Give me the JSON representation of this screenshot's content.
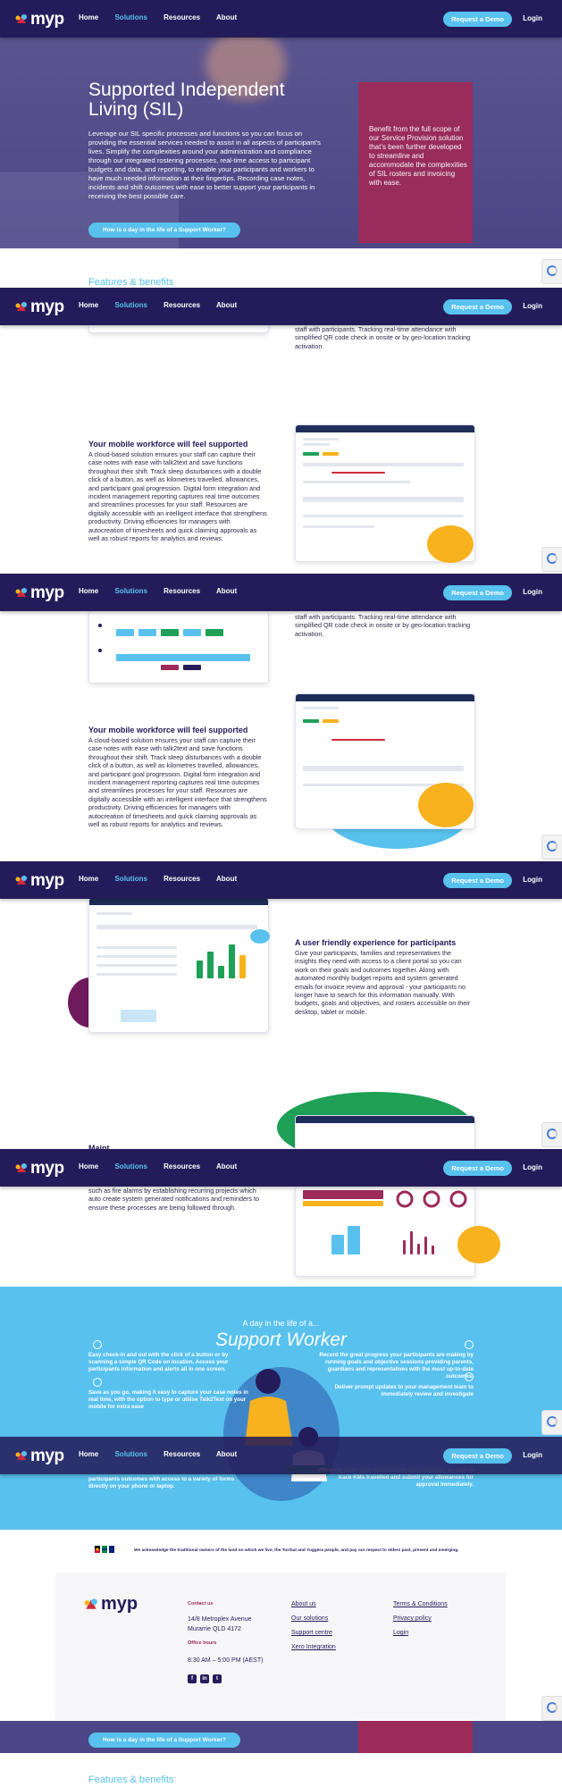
{
  "nav": {
    "logo": "myp",
    "links": [
      "Home",
      "Solutions",
      "Resources",
      "About"
    ],
    "active": "Solutions",
    "demo_button": "Request a Demo",
    "login": "Login"
  },
  "hero": {
    "title": "Supported Independent Living (SIL)",
    "body": "Leverage our SIL specific processes and functions so you can focus on providing the essential services needed to assist in all aspects of participant’s lives.  Simplify the complexities around your administration and compliance through our integrated rostering processes, real-time access to participant budgets and data, and reporting, to enable your participants and workers to have much needed information at their fingertips. Recording case notes, incidents and shift outcomes with ease to better support your participants in receiving the best possible care.",
    "cta": "How is a day in the life of a Support Worker?",
    "panel": "Benefit from the full scope of our Service Provision solution that’s been further developed to streamline and accommodate the complexities of SIL rosters and invoicing with ease."
  },
  "features_heading": "Features & benefits",
  "attendance_text": "staff with participants. Tracking real-time attendance with simplified QR code check in onsite or by geo-location tracking activation.",
  "mobile": {
    "heading": "Your mobile workforce will feel supported",
    "body": "A cloud-based solution ensures your staff can capture their case notes with ease with talk2text and save functions throughout their shift.  Track sleep disturbances with a double click of a button, as well as kilometres travelled, allowances, and participant goal progression.  Digital form integration and incident management reporting captures real time outcomes and streamlines processes for your staff.  Resources are digitally accessible with an intelligent interface that strengthens productivity.  Driving efficiencies for managers with autocreation of timesheets and quick claiming approvals as well as robust reports for analytics and reviews."
  },
  "ux": {
    "heading": "A user friendly experience for participants",
    "body": "Give your participants, families and representatives the insights they need with access to a client portal so you can work on their goals and outcomes together.  Along with automated monthly budget reports and system generated emails for invoice review and approval - your participants no longer have to search for this information manually.  With budgets, goals and objectives, and rosters accessible on their desktop, tablet or mobile."
  },
  "fragment_heading": "Maint",
  "recurring_text": "such as fire alarms by establishing recurring projects which auto create system generated notifications and reminders to ensure these processes are being followed through.",
  "support_worker": {
    "above": "A day in the life of a...",
    "title": "Support Worker",
    "left": [
      "Easy check-in and out with the click of a button or by scanning a simple QR Code on location. Access your participants information and alerts all in one screen.",
      "Save as you go, making it easy to capture your case notes in real time, with the option to type or utilise Talk2Text on your mobile for extra ease",
      "participants outcomes with access to a variety of forms directly on your phone or laptop."
    ],
    "right": [
      "Record the great progress your participants are making by running goals and objective sessions providing parents, guardians and representatives with the most up-to-date outcomes.",
      "Deliver prompt updates to your management team to immediately review and investigate",
      "efficiently meet shift expectations and outcomes, as well as track KMs travelled and submit your allowances for approval immediately."
    ]
  },
  "acknowledgement": "We acknowledge the traditional owners of the land on which we live, the Turrbal and Yuggera people, and pay our respect to elders past, present and emerging.",
  "footer": {
    "logo": "myp",
    "contact_label": "Contact us",
    "address_1": "14/8 Metroplex Avenue",
    "address_2": "Murarrie QLD 4172",
    "office_label": "Office hours",
    "hours": "8:30 AM – 5:00 PM (AEST)",
    "col1": [
      "About us",
      "Our solutions",
      "Support centre",
      "Xero Integration"
    ],
    "col2": [
      "Terms & Conditions",
      "Privacy policy",
      "Login"
    ]
  },
  "colors": {
    "navy": "#241c5a",
    "sky": "#58c1ee",
    "plum": "#9c2b5a",
    "yellow": "#f7b21e",
    "green": "#1ea056"
  }
}
